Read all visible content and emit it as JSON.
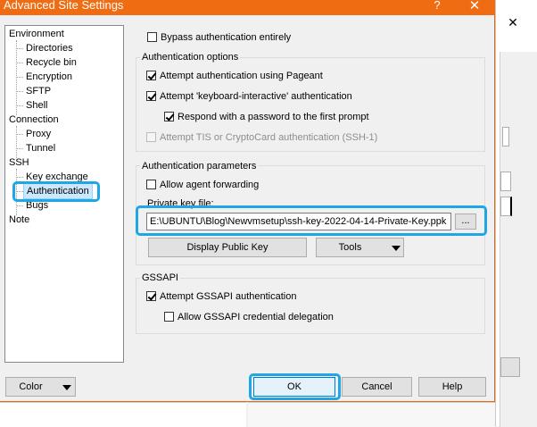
{
  "window": {
    "title": "Advanced Site Settings",
    "help_glyph": "?",
    "close_glyph": "✕"
  },
  "background_window": {
    "close_glyph": "✕"
  },
  "tree": {
    "items": [
      {
        "label": "Environment",
        "level": 0
      },
      {
        "label": "Directories",
        "level": 1
      },
      {
        "label": "Recycle bin",
        "level": 1
      },
      {
        "label": "Encryption",
        "level": 1
      },
      {
        "label": "SFTP",
        "level": 1
      },
      {
        "label": "Shell",
        "level": 1
      },
      {
        "label": "Connection",
        "level": 0
      },
      {
        "label": "Proxy",
        "level": 1
      },
      {
        "label": "Tunnel",
        "level": 1
      },
      {
        "label": "SSH",
        "level": 0
      },
      {
        "label": "Key exchange",
        "level": 1
      },
      {
        "label": "Authentication",
        "level": 1,
        "selected": true
      },
      {
        "label": "Bugs",
        "level": 1
      },
      {
        "label": "Note",
        "level": 0
      }
    ]
  },
  "bypass": {
    "label": "Bypass authentication entirely",
    "checked": false
  },
  "auth_options": {
    "title": "Authentication options",
    "pageant": {
      "label": "Attempt authentication using Pageant",
      "checked": true
    },
    "keyboard_interactive": {
      "label": "Attempt 'keyboard-interactive' authentication",
      "checked": true
    },
    "respond_password": {
      "label": "Respond with a password to the first prompt",
      "checked": true
    },
    "tis": {
      "label": "Attempt TIS or CryptoCard authentication (SSH-1)",
      "checked": false,
      "disabled": true
    }
  },
  "auth_params": {
    "title": "Authentication parameters",
    "agent_forwarding": {
      "label": "Allow agent forwarding",
      "checked": false
    },
    "private_key_label": "Private key file:",
    "private_key_value": "E:\\UBUNTU\\Blog\\Newvmsetup\\ssh-key-2022-04-14-Private-Key.ppk",
    "browse_label": "...",
    "display_public_key": "Display Public Key",
    "tools": "Tools"
  },
  "gssapi": {
    "title": "GSSAPI",
    "attempt": {
      "label": "Attempt GSSAPI authentication",
      "checked": true
    },
    "delegation": {
      "label": "Allow GSSAPI credential delegation",
      "checked": false
    }
  },
  "footer": {
    "color": "Color",
    "ok": "OK",
    "cancel": "Cancel",
    "help": "Help"
  },
  "colors": {
    "titlebar": "#ef6c12",
    "highlight": "#1fa6e6",
    "selected_bg": "#cce8ff"
  }
}
